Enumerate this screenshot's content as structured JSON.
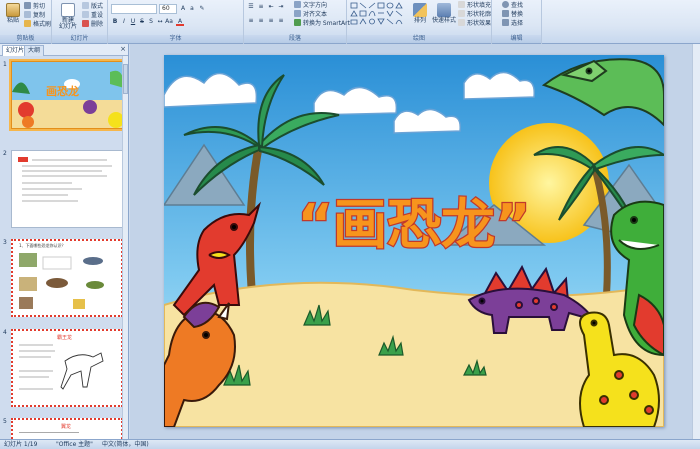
{
  "ribbon": {
    "clipboard": {
      "group_label": "剪贴板",
      "paste_label": "粘贴",
      "cut_label": "剪切",
      "copy_label": "复制",
      "format_painter_label": "格式刷"
    },
    "slides": {
      "group_label": "幻灯片",
      "new_slide_label": "新建\n幻灯片",
      "layout_label": "版式",
      "reset_label": "重设",
      "delete_label": "删除"
    },
    "font": {
      "group_label": "字体",
      "font_name": "",
      "font_size": "60"
    },
    "paragraph": {
      "group_label": "段落",
      "text_direction_label": "文字方向",
      "align_text_label": "对齐文本",
      "smartart_label": "转换为 SmartArt"
    },
    "drawing": {
      "group_label": "绘图",
      "arrange_label": "排列",
      "quick_styles_label": "快速样式",
      "shape_fill_label": "形状填充",
      "shape_outline_label": "形状轮廓",
      "shape_effects_label": "形状效果"
    },
    "editing": {
      "group_label": "编辑",
      "find_label": "查找",
      "replace_label": "替换",
      "select_label": "选择"
    }
  },
  "left_pane": {
    "tabs": [
      "幻灯片",
      "大纲"
    ],
    "close_glyph": "×",
    "thumbnails": [
      {
        "number": "1",
        "selected": true
      },
      {
        "number": "2",
        "selected": false
      },
      {
        "number": "3",
        "selected": false
      },
      {
        "number": "4",
        "selected": false
      },
      {
        "number": "5",
        "selected": false
      }
    ],
    "thumb3_title": "1、下面哪些恐龙你认识？",
    "thumb4_title": "霸王龙",
    "thumb5_title": "翼龙"
  },
  "slide": {
    "title": "“画恐龙”"
  },
  "status": {
    "slide_counter": "幻灯片 1/19",
    "theme": "\"Office 主题\"",
    "language": "中文(简体，中国)"
  },
  "colors": {
    "ribbon_bg": "#dbe6f4",
    "selected_thumb": "#f6b64a",
    "title_orange": "#f7941d",
    "sky_blue": "#5bb4e6",
    "sand": "#f7e3a2"
  }
}
